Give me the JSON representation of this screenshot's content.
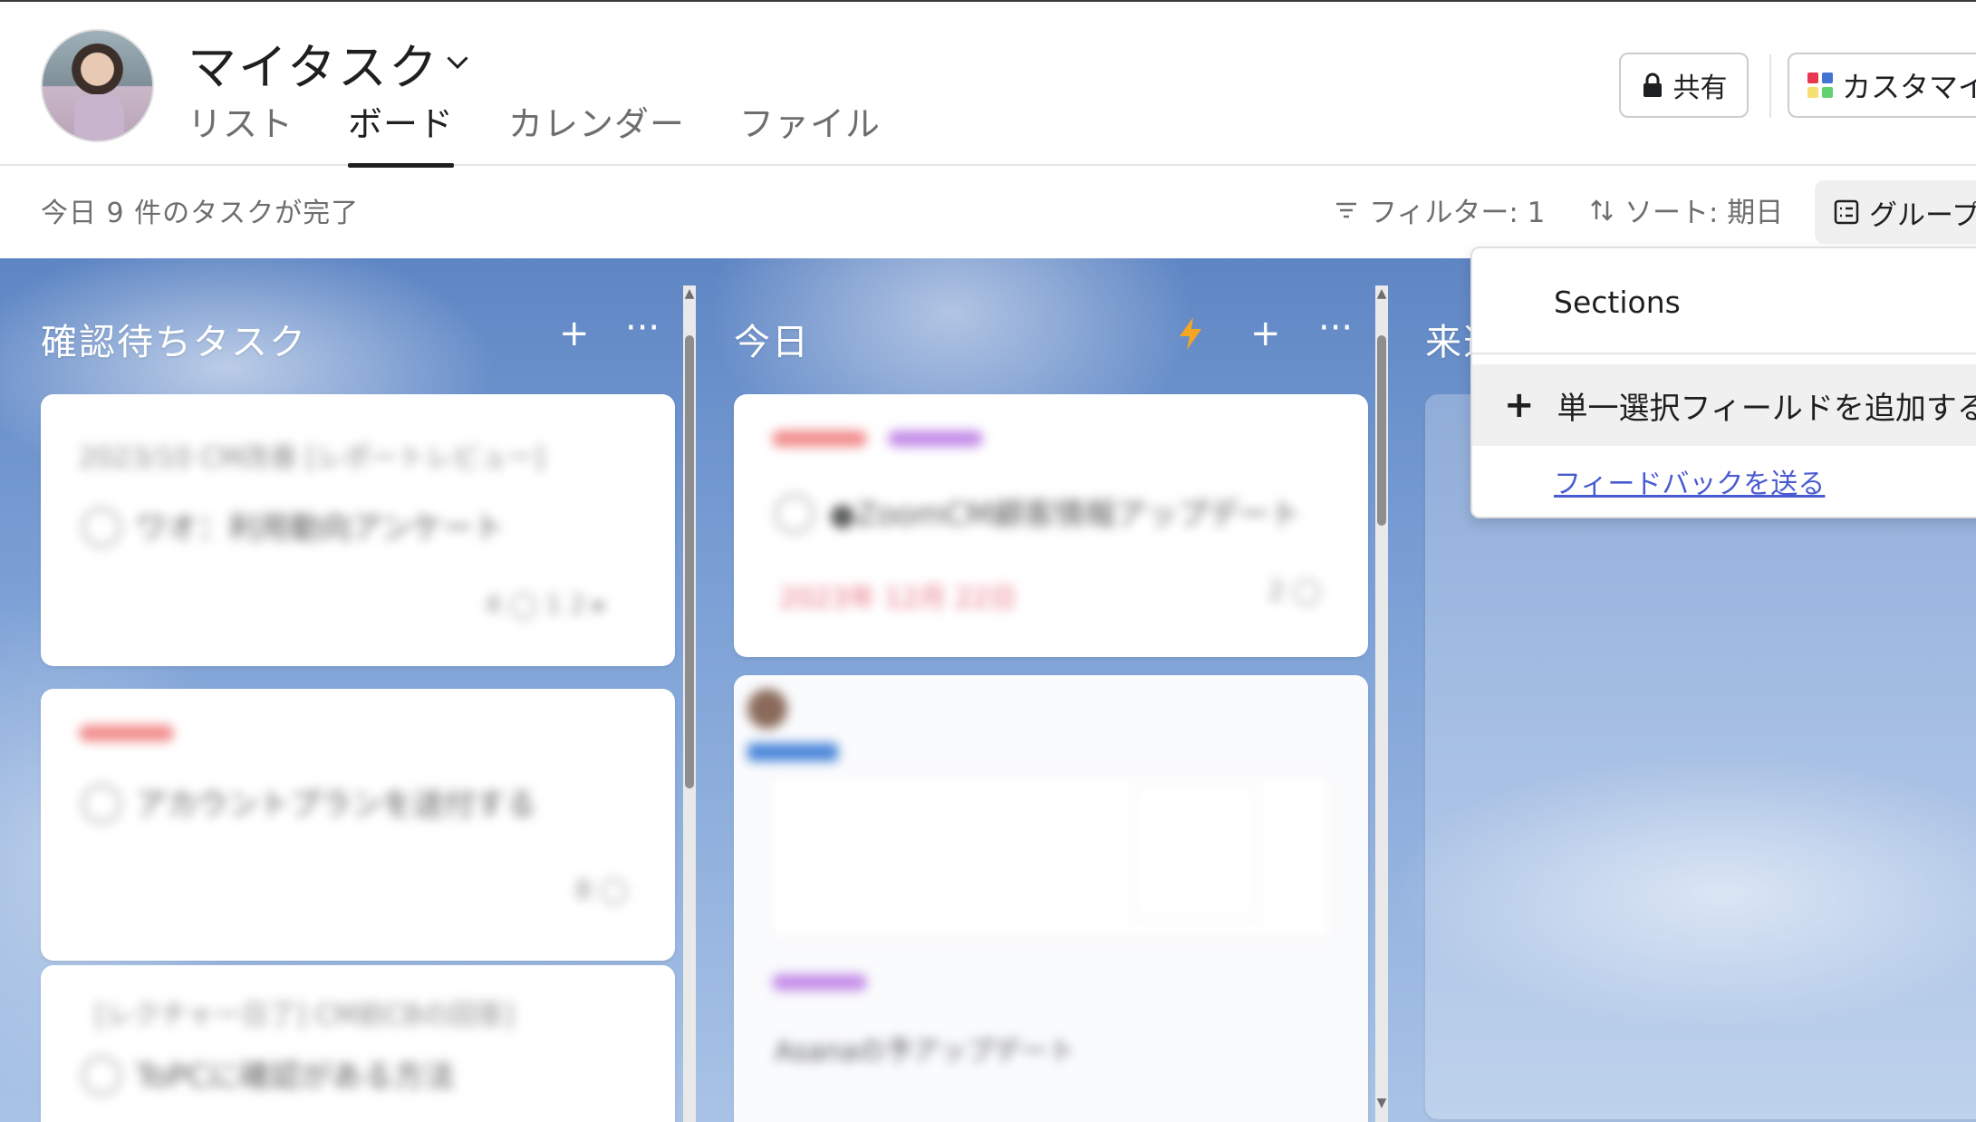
{
  "header": {
    "project_title": "マイタスク",
    "tabs": [
      {
        "label": "リスト",
        "active": false
      },
      {
        "label": "ボード",
        "active": true
      },
      {
        "label": "カレンダー",
        "active": false
      },
      {
        "label": "ファイル",
        "active": false
      }
    ],
    "share_label": "共有",
    "customize_label": "カスタマイズ"
  },
  "toolbar": {
    "status": "今日 9 件のタスクが完了",
    "filter_label": "フィルター: 1",
    "sort_label": "ソート: 期日",
    "group_label": "グループ"
  },
  "board": {
    "columns": [
      {
        "title": "確認待ちタスク"
      },
      {
        "title": "今日"
      },
      {
        "title": "来週"
      }
    ],
    "colors": {
      "lightning": "#f5a524",
      "tag_red": "#f28b8b",
      "tag_purple": "#c38ce8",
      "tag_blue": "#4a86d9"
    }
  },
  "dropdown": {
    "section_label": "Sections",
    "add_field_label": "単一選択フィールドを追加する",
    "feedback_link": "フィードバックを送る"
  }
}
